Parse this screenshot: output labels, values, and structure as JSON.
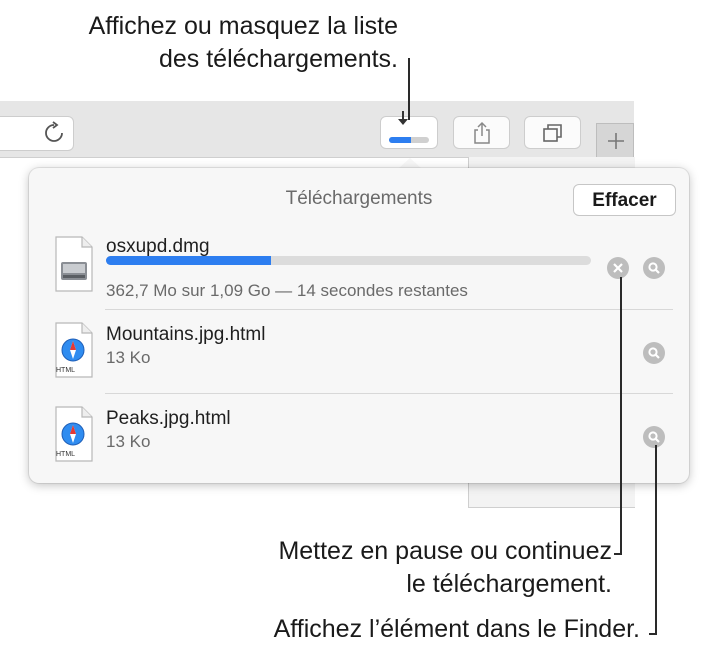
{
  "callouts": {
    "top_line1": "Affichez ou masquez la liste",
    "top_line2": "des téléchargements.",
    "pause_line1": "Mettez en pause ou continuez",
    "pause_line2": "le téléchargement.",
    "finder": "Affichez l’élément dans le Finder."
  },
  "toolbar": {
    "downloads_progress": 0.55,
    "icons": [
      "reload-icon",
      "download-arrow-icon",
      "share-icon",
      "tabs-icon",
      "plus-icon"
    ]
  },
  "popover": {
    "title": "Téléchargements",
    "clear_label": "Effacer",
    "items": [
      {
        "name": "osxupd.dmg",
        "detail": "362,7 Mo sur 1,09 Go — 14 secondes restantes",
        "progress": 0.34,
        "icon": "disk-image-icon",
        "in_progress": true
      },
      {
        "name": "Mountains.jpg.html",
        "detail": "13 Ko",
        "icon": "safari-html-icon",
        "icon_label": "HTML",
        "in_progress": false
      },
      {
        "name": "Peaks.jpg.html",
        "detail": "13 Ko",
        "icon": "safari-html-icon",
        "icon_label": "HTML",
        "in_progress": false
      }
    ]
  },
  "colors": {
    "accent": "#2d7ef0",
    "panel": "#f7f7f7",
    "button_gray": "#bdbdbd"
  }
}
